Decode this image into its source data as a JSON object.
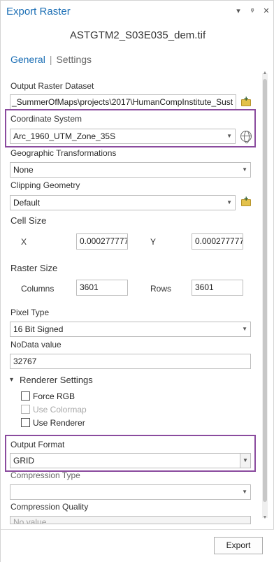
{
  "window": {
    "title": "Export Raster",
    "icons": [
      "dropdown-icon",
      "pin-icon",
      "close-icon"
    ]
  },
  "tool": {
    "title": "ASTGTM2_S03E035_dem.tif"
  },
  "tabs": {
    "general": "General",
    "separator": "|",
    "settings": "Settings"
  },
  "output_raster": {
    "label": "Output Raster Dataset",
    "value": "_SummerOfMaps\\projects\\2017\\HumanCompInstitute_Sust"
  },
  "coordinate_system": {
    "label": "Coordinate System",
    "value": "Arc_1960_UTM_Zone_35S"
  },
  "geo_transformations": {
    "label": "Geographic Transformations",
    "value": "None"
  },
  "clipping_geometry": {
    "label": "Clipping Geometry",
    "value": "Default"
  },
  "cell_size": {
    "label": "Cell Size",
    "x_label": "X",
    "x_value": "0.000277777",
    "y_label": "Y",
    "y_value": "0.000277777"
  },
  "raster_size": {
    "label": "Raster Size",
    "columns_label": "Columns",
    "columns_value": "3601",
    "rows_label": "Rows",
    "rows_value": "3601"
  },
  "pixel_type": {
    "label": "Pixel Type",
    "value": "16 Bit Signed"
  },
  "nodata": {
    "label": "NoData value",
    "value": "32767"
  },
  "renderer": {
    "label": "Renderer Settings",
    "force_rgb": "Force RGB",
    "use_colormap": "Use Colormap",
    "use_renderer": "Use Renderer"
  },
  "output_format": {
    "label": "Output Format",
    "value": "GRID"
  },
  "compression_type": {
    "label": "Compression Type",
    "value": ""
  },
  "compression_quality": {
    "label": "Compression Quality",
    "placeholder": "No value"
  },
  "footer": {
    "export_label": "Export"
  },
  "colors": {
    "accent": "#1c6fb5",
    "highlight": "#8a4b9e"
  }
}
